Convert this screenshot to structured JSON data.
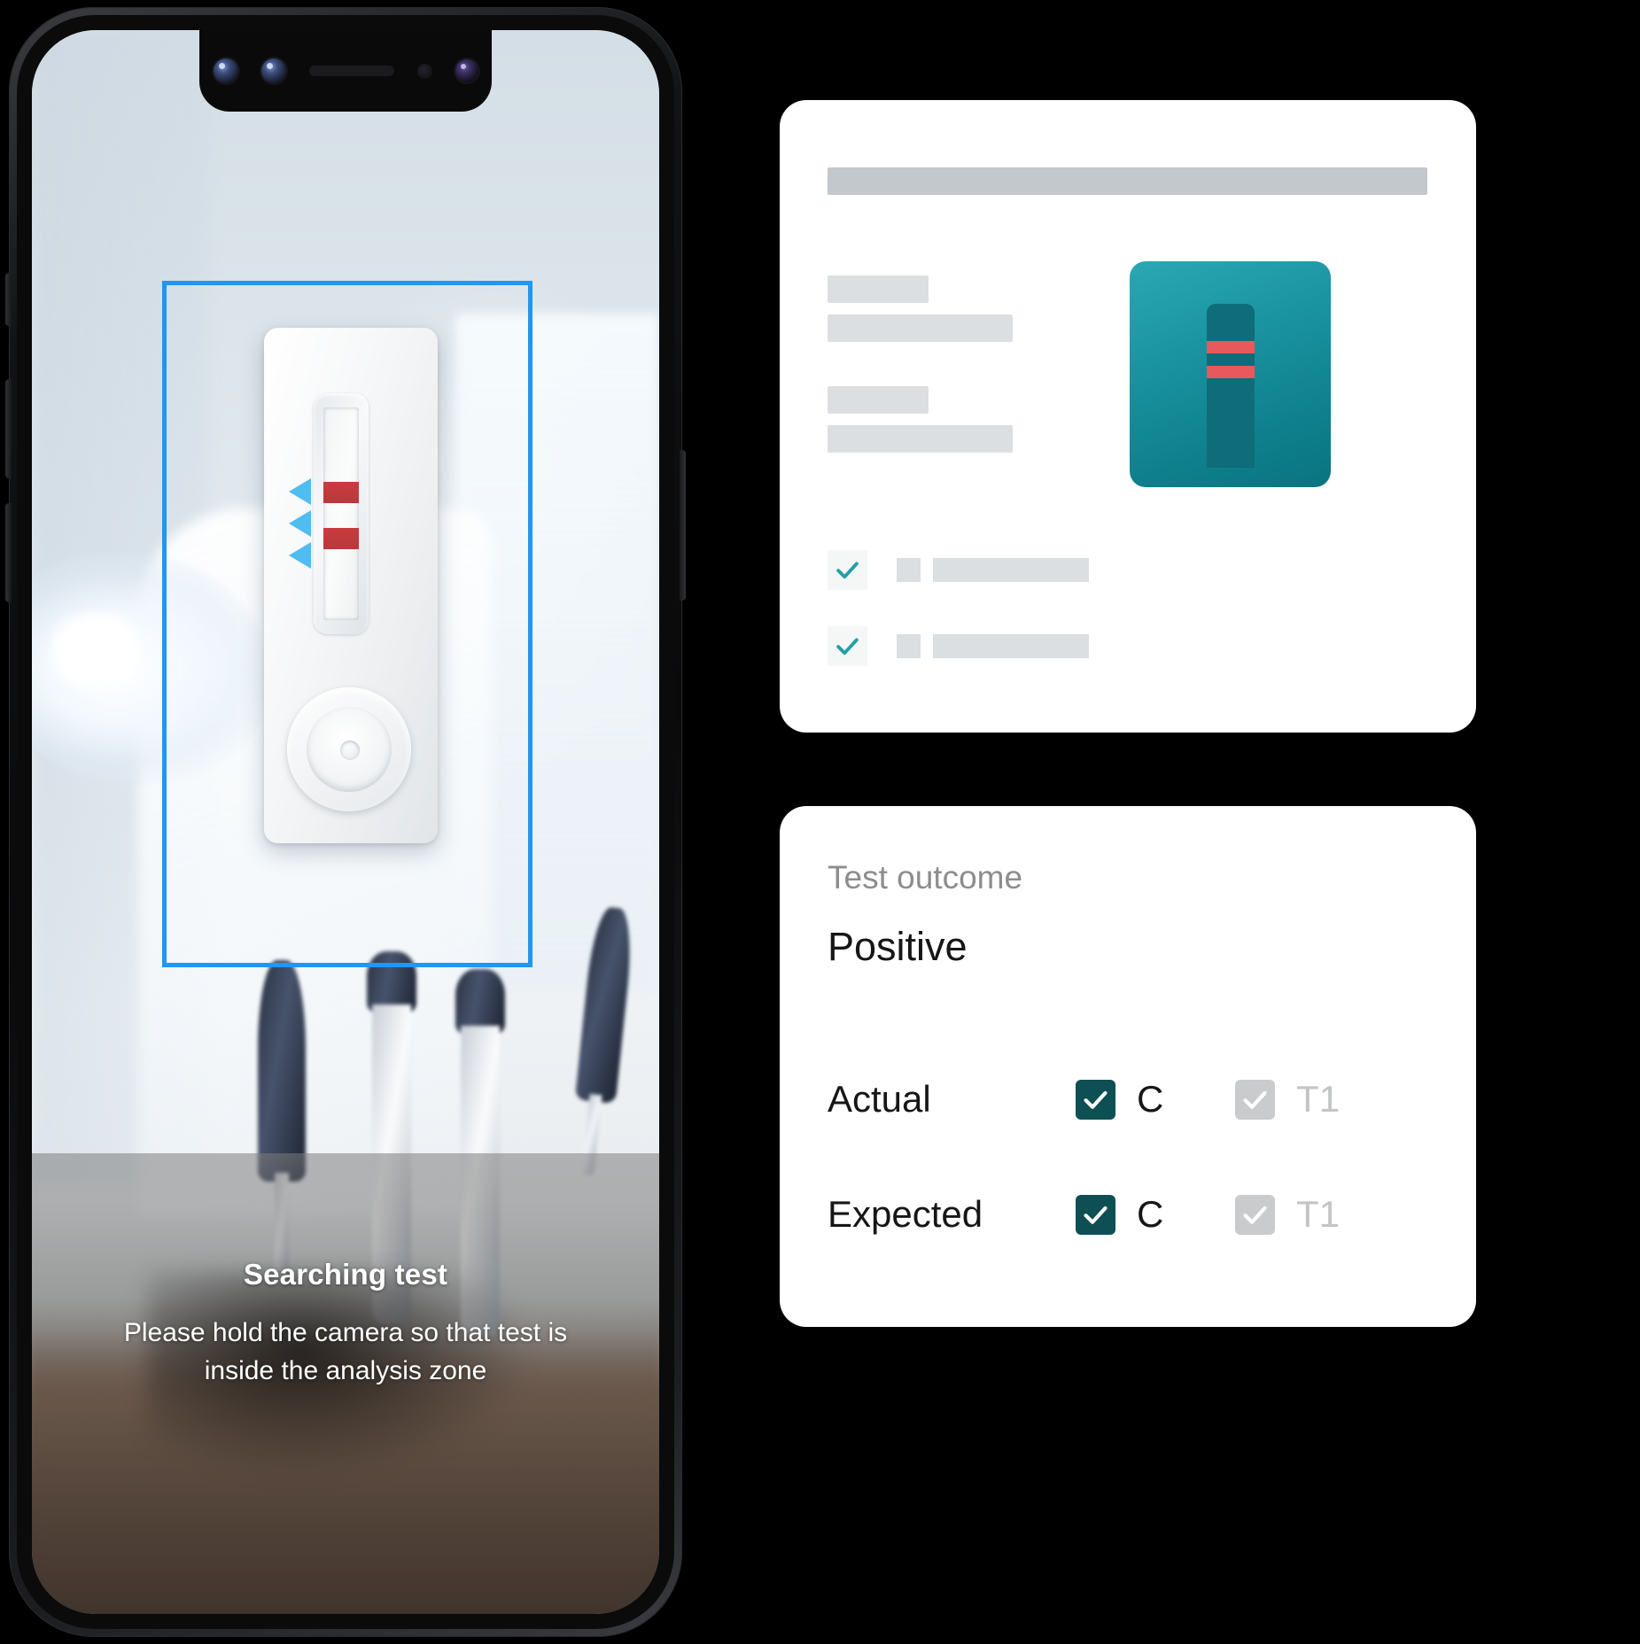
{
  "phone": {
    "camera_view": {
      "analysis_zone_color": "#2196f3",
      "test_strip": {
        "lines": [
          "C",
          "T1"
        ],
        "line_color": "#c93b3f"
      },
      "arrows_color": "#4ebdf0"
    },
    "overlay": {
      "title": "Searching test",
      "subtitle": "Please hold the camera so that test is inside the analysis zone"
    }
  },
  "skeleton_card": {
    "thumbnail": {
      "background_color": "#1a93a0",
      "strip_color": "#0e6d78",
      "line_color": "#e8595b",
      "lines": 2
    },
    "checkbox_rows": [
      {
        "checked": true,
        "check_color": "#21a0ab"
      },
      {
        "checked": true,
        "check_color": "#21a0ab"
      }
    ]
  },
  "outcome_card": {
    "label": "Test outcome",
    "value": "Positive",
    "rows": [
      {
        "label": "Actual",
        "checks": [
          {
            "name": "C",
            "checked": true,
            "enabled": true
          },
          {
            "name": "T1",
            "checked": true,
            "enabled": false
          }
        ]
      },
      {
        "label": "Expected",
        "checks": [
          {
            "name": "C",
            "checked": true,
            "enabled": true
          },
          {
            "name": "T1",
            "checked": true,
            "enabled": false
          }
        ]
      }
    ],
    "accent_color": "#0d4f52",
    "disabled_color": "#c9cbcc"
  }
}
